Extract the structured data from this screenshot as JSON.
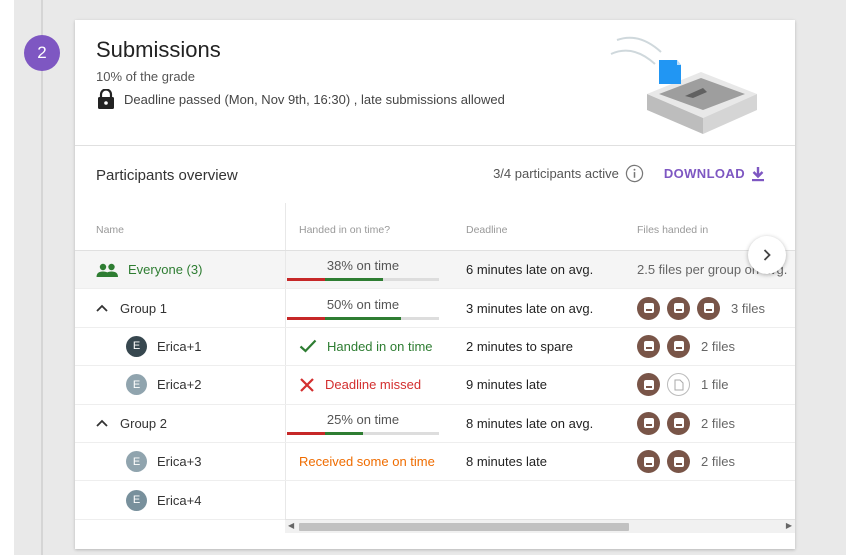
{
  "step_number": "2",
  "header": {
    "title": "Submissions",
    "subtitle": "10% of the grade",
    "deadline": "Deadline passed (Mon, Nov 9th, 16:30) , late submissions allowed"
  },
  "overview": {
    "title": "Participants overview",
    "active": "3/4 participants active",
    "download": "DOWNLOAD"
  },
  "columns": {
    "name": "Name",
    "time": "Handed in on time?",
    "deadline": "Deadline",
    "files": "Files handed in"
  },
  "rows": {
    "everyone": {
      "name": "Everyone (3)",
      "on_time": "38% on time",
      "on_time_fraction": 0.38,
      "deadline": "6 minutes late on avg.",
      "files": "2.5 files per group on avg."
    },
    "group1": {
      "name": "Group 1",
      "on_time": "50% on time",
      "on_time_fraction": 0.5,
      "deadline": "3 minutes late on avg.",
      "files": "3 files"
    },
    "erica1": {
      "initial": "E",
      "name": "Erica+1",
      "status": "Handed in on time",
      "deadline": "2 minutes to spare",
      "files": "2 files"
    },
    "erica2": {
      "initial": "E",
      "name": "Erica+2",
      "status": "Deadline missed",
      "deadline": "9 minutes late",
      "files": "1 file"
    },
    "group2": {
      "name": "Group 2",
      "on_time": "25% on time",
      "on_time_fraction": 0.25,
      "deadline": "8 minutes late on avg.",
      "files": "2 files"
    },
    "erica3": {
      "initial": "E",
      "name": "Erica+3",
      "status": "Received some on time",
      "deadline": "8 minutes late",
      "files": "2 files"
    },
    "erica4": {
      "initial": "E",
      "name": "Erica+4"
    }
  },
  "colors": {
    "accent": "#7e57c2",
    "success": "#2e7d32",
    "error": "#d32f2f",
    "warning": "#ef6c00",
    "file_icon": "#795548"
  }
}
